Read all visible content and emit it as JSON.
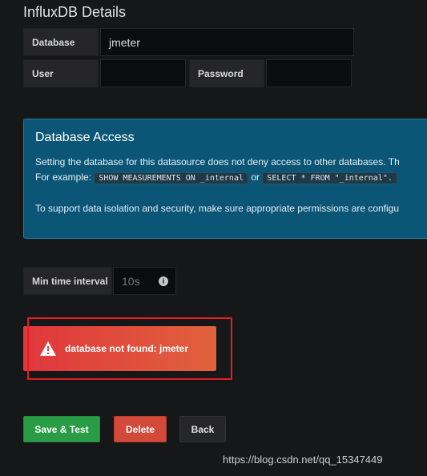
{
  "section_title": "InfluxDB Details",
  "fields": {
    "database": {
      "label": "Database",
      "value": "jmeter"
    },
    "user": {
      "label": "User",
      "value": ""
    },
    "password": {
      "label": "Password",
      "value": ""
    }
  },
  "database_access": {
    "title": "Database Access",
    "line1": "Setting the database for this datasource does not deny access to other databases. Th",
    "example_prefix": "For example:",
    "example_code1": "SHOW MEASUREMENTS ON _internal",
    "example_or": "or",
    "example_code2": "SELECT * FROM \"_internal\".",
    "line3": "To support data isolation and security, make sure appropriate permissions are configu"
  },
  "min_time_interval": {
    "label": "Min time interval",
    "placeholder": "10s",
    "icon": "info-circle-icon"
  },
  "alert": {
    "message": "database not found: jmeter",
    "icon": "warning-triangle-icon",
    "color": "#e0373c"
  },
  "buttons": {
    "save_test": "Save & Test",
    "delete": "Delete",
    "back": "Back"
  },
  "watermark": "https://blog.csdn.net/qq_15347449",
  "colors": {
    "background": "#161719",
    "info_box": "#0b5676",
    "save": "#299c46",
    "delete": "#d44a3a",
    "highlight_frame": "#e01e24"
  }
}
